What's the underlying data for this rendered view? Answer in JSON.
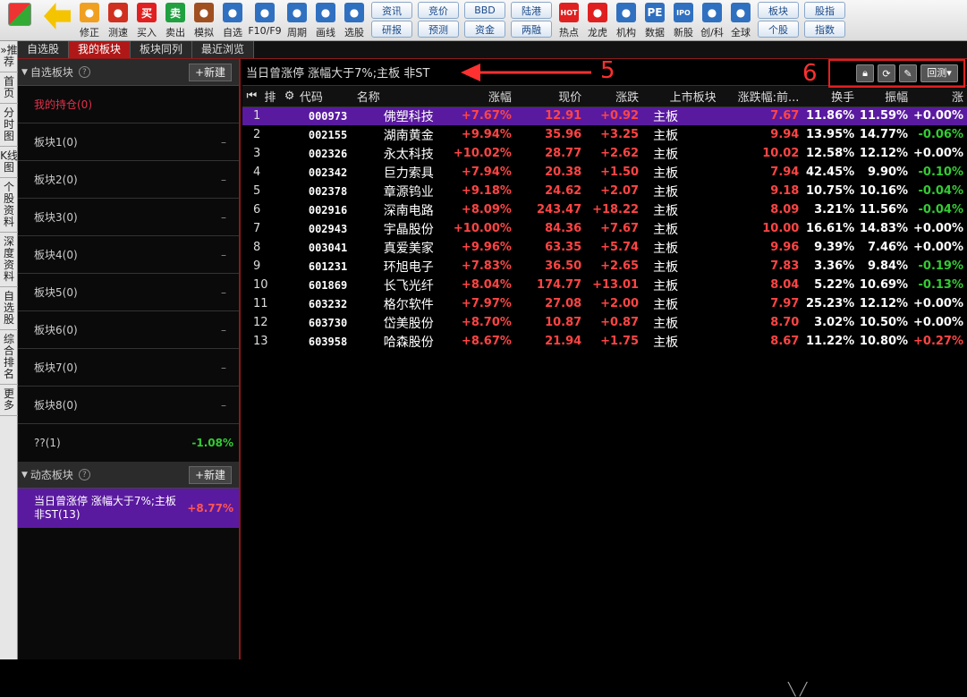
{
  "toolbar": {
    "buttons": [
      {
        "label": "修正",
        "icon": "refresh-icon",
        "color": "#f0a020"
      },
      {
        "label": "测速",
        "icon": "clock-icon",
        "color": "#d03020"
      },
      {
        "label": "买入",
        "icon": "buy-icon",
        "color": "#e02020",
        "glyph": "买"
      },
      {
        "label": "卖出",
        "icon": "sell-icon",
        "color": "#20a040",
        "glyph": "卖"
      },
      {
        "label": "模拟",
        "icon": "hammer-icon",
        "color": "#a05020"
      },
      {
        "label": "自选",
        "icon": "star-icon",
        "color": "#3070c0"
      },
      {
        "label": "F10/F9",
        "icon": "f10-icon",
        "color": "#3070c0"
      },
      {
        "label": "周期",
        "icon": "cycle-icon",
        "color": "#3070c0"
      },
      {
        "label": "画线",
        "icon": "pen-icon",
        "color": "#3070c0"
      },
      {
        "label": "选股",
        "icon": "select-stock-icon",
        "color": "#3070c0"
      }
    ],
    "pairs": [
      [
        "资讯",
        "研报"
      ],
      [
        "竞价",
        "预测"
      ],
      [
        "BBD",
        "资金"
      ],
      [
        "陆港",
        "两融"
      ]
    ],
    "buttons2": [
      {
        "label": "热点",
        "icon": "hot-icon",
        "color": "#e02020",
        "glyph": "HOT"
      },
      {
        "label": "龙虎",
        "icon": "dragon-icon",
        "color": "#e02020"
      },
      {
        "label": "机构",
        "icon": "institution-icon",
        "color": "#3070c0"
      },
      {
        "label": "数据",
        "icon": "pe-data-icon",
        "color": "#3070c0",
        "glyph": "PE"
      },
      {
        "label": "新股",
        "icon": "ipo-icon",
        "color": "#3070c0",
        "glyph": "IPO"
      },
      {
        "label": "创/科",
        "icon": "chuangke-icon",
        "color": "#3070c0"
      },
      {
        "label": "全球",
        "icon": "globe-icon",
        "color": "#3070c0"
      }
    ],
    "pairs2": [
      [
        "板块",
        "个股"
      ],
      [
        "股指",
        "指数"
      ]
    ]
  },
  "tabs": [
    "自选股",
    "我的板块",
    "板块同列",
    "最近浏览"
  ],
  "left_nav": [
    "»推荐",
    "首页",
    "分时图",
    "K线图",
    "个股资料",
    "深度资料",
    "自选股",
    "综合排名",
    "更多"
  ],
  "sidebar": {
    "section1": {
      "title": "自选板块",
      "new_label": "+新建"
    },
    "groups": [
      "我的持仓(0)",
      "板块1(0)",
      "板块2(0)",
      "板块3(0)",
      "板块4(0)",
      "板块5(0)",
      "板块6(0)",
      "板块7(0)",
      "板块8(0)"
    ],
    "unknown": {
      "label": "??(1)",
      "pct": "-1.08%"
    },
    "section2": {
      "title": "动态板块",
      "new_label": "+新建"
    },
    "dynamic": {
      "label": "当日曾涨停 涨幅大于7%;主板 非ST(13)",
      "pct": "+8.77%"
    }
  },
  "main": {
    "title": "当日曾涨停 涨幅大于7%;主板 非ST",
    "anno5": "5",
    "anno6": "6",
    "backtest_label": "回测▾",
    "columns": [
      "代码",
      "名称",
      "涨幅",
      "现价",
      "涨跌",
      "上市板块",
      "涨跌幅:前...",
      "换手",
      "振幅",
      "涨"
    ],
    "rows": [
      [
        "1",
        "000973",
        "佛塑科技",
        "+7.67%",
        "12.91",
        "+0.92",
        "主板",
        "7.67",
        "11.86%",
        "11.59%",
        "+0.00%"
      ],
      [
        "2",
        "002155",
        "湖南黄金",
        "+9.94%",
        "35.96",
        "+3.25",
        "主板",
        "9.94",
        "13.95%",
        "14.77%",
        "-0.06%"
      ],
      [
        "3",
        "002326",
        "永太科技",
        "+10.02%",
        "28.77",
        "+2.62",
        "主板",
        "10.02",
        "12.58%",
        "12.12%",
        "+0.00%"
      ],
      [
        "4",
        "002342",
        "巨力索具",
        "+7.94%",
        "20.38",
        "+1.50",
        "主板",
        "7.94",
        "42.45%",
        "9.90%",
        "-0.10%"
      ],
      [
        "5",
        "002378",
        "章源钨业",
        "+9.18%",
        "24.62",
        "+2.07",
        "主板",
        "9.18",
        "10.75%",
        "10.16%",
        "-0.04%"
      ],
      [
        "6",
        "002916",
        "深南电路",
        "+8.09%",
        "243.47",
        "+18.22",
        "主板",
        "8.09",
        "3.21%",
        "11.56%",
        "-0.04%"
      ],
      [
        "7",
        "002943",
        "宇晶股份",
        "+10.00%",
        "84.36",
        "+7.67",
        "主板",
        "10.00",
        "16.61%",
        "14.83%",
        "+0.00%"
      ],
      [
        "8",
        "003041",
        "真爱美家",
        "+9.96%",
        "63.35",
        "+5.74",
        "主板",
        "9.96",
        "9.39%",
        "7.46%",
        "+0.00%"
      ],
      [
        "9",
        "601231",
        "环旭电子",
        "+7.83%",
        "36.50",
        "+2.65",
        "主板",
        "7.83",
        "3.36%",
        "9.84%",
        "-0.19%"
      ],
      [
        "10",
        "601869",
        "长飞光纤",
        "+8.04%",
        "174.77",
        "+13.01",
        "主板",
        "8.04",
        "5.22%",
        "10.69%",
        "-0.13%"
      ],
      [
        "11",
        "603232",
        "格尔软件",
        "+7.97%",
        "27.08",
        "+2.00",
        "主板",
        "7.97",
        "25.23%",
        "12.12%",
        "+0.00%"
      ],
      [
        "12",
        "603730",
        "岱美股份",
        "+8.70%",
        "10.87",
        "+0.87",
        "主板",
        "8.70",
        "3.02%",
        "10.50%",
        "+0.00%"
      ],
      [
        "13",
        "603958",
        "哈森股份",
        "+8.67%",
        "21.94",
        "+1.75",
        "主板",
        "8.67",
        "11.22%",
        "10.80%",
        "+0.27%"
      ]
    ]
  }
}
